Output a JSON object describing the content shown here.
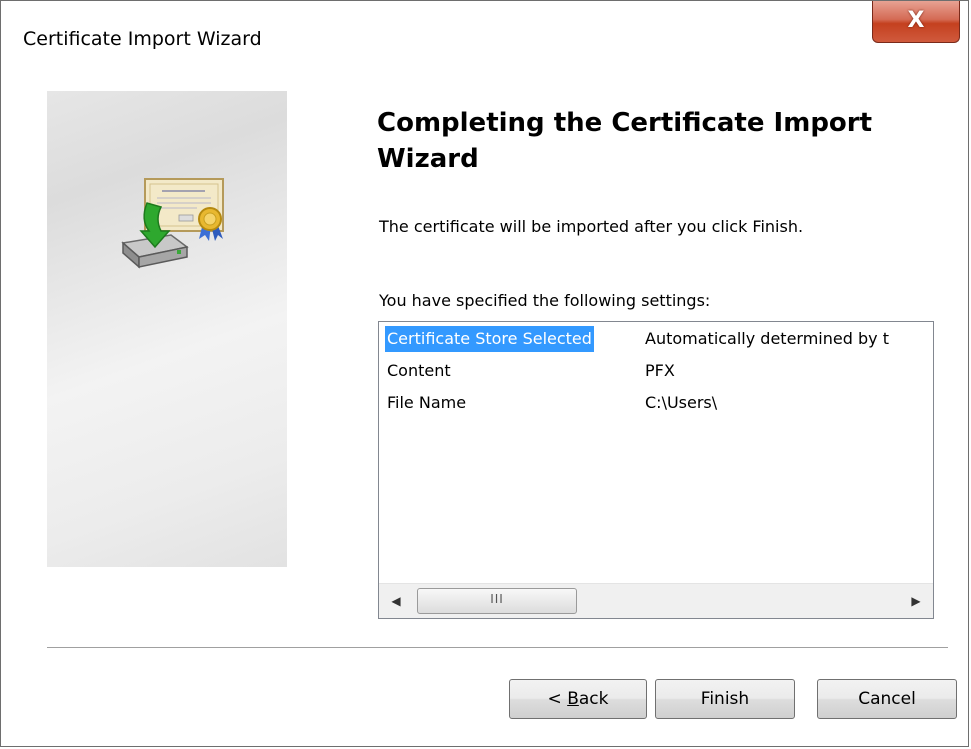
{
  "window": {
    "title": "Certificate Import Wizard",
    "close_glyph": "X"
  },
  "heading": "Completing the Certificate Import Wizard",
  "description": "The certificate will be imported after you click Finish.",
  "settings_label": "You have specified the following settings:",
  "settings": [
    {
      "field": "Certificate Store Selected",
      "value": "Automatically determined by t",
      "selected": true
    },
    {
      "field": "Content",
      "value": "PFX",
      "selected": false
    },
    {
      "field": "File Name",
      "value": "C:\\Users\\",
      "selected": false
    }
  ],
  "scrollbar": {
    "left_arrow": "◀",
    "right_arrow": "▶",
    "grip": "III"
  },
  "buttons": {
    "back_prefix": "< ",
    "back_mnemonic": "B",
    "back_rest": "ack",
    "finish": "Finish",
    "cancel": "Cancel"
  },
  "icons": {
    "wizard_graphic": "certificate-import-icon"
  },
  "colors": {
    "selection": "#3399ff",
    "close_button": "#c4401f"
  }
}
